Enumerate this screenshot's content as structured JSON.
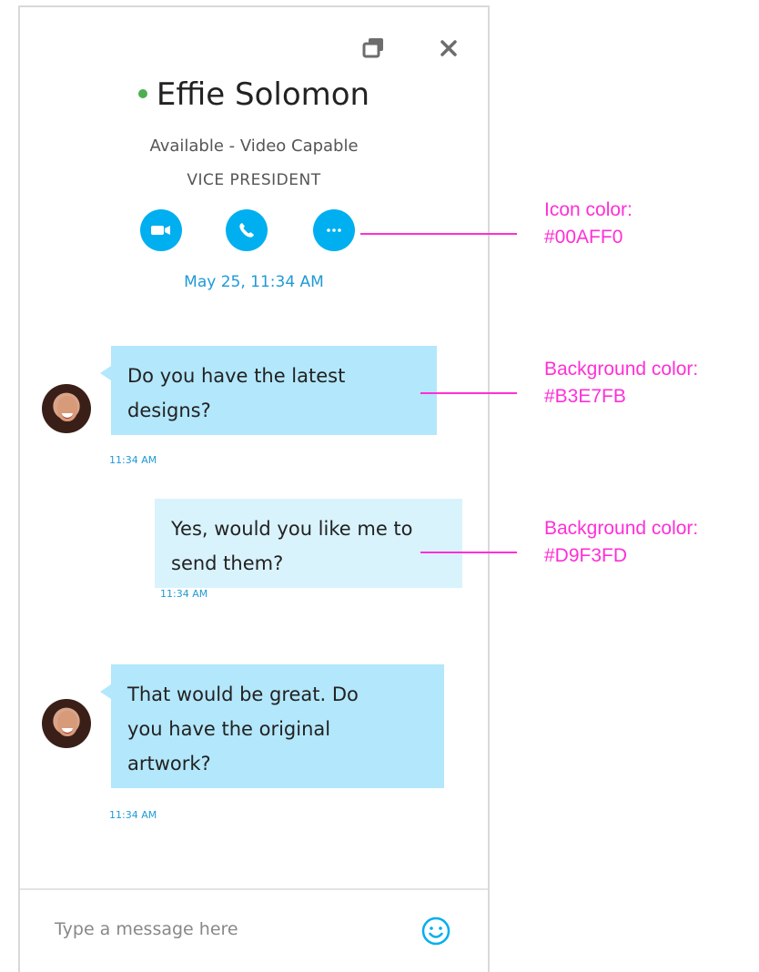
{
  "contact": {
    "name": "Effie Solomon",
    "status": "Available - Video Capable",
    "title": "VICE PRESIDENT",
    "presence_color": "#4caf50"
  },
  "icons": {
    "window": [
      "popout-icon",
      "close-icon"
    ],
    "calls": [
      "video-call-icon",
      "phone-call-icon",
      "more-options-icon"
    ],
    "composer": "emoji-icon"
  },
  "colors": {
    "icon": "#00AFF0",
    "incoming_bubble": "#B3E7FB",
    "outgoing_bubble": "#D9F3FD",
    "timestamp": "#1f9ad6"
  },
  "conversation": {
    "date": "May 25, 11:34 AM",
    "messages": [
      {
        "direction": "incoming",
        "lines": [
          "Do you have the latest",
          "designs?"
        ],
        "time": "11:34 AM"
      },
      {
        "direction": "outgoing",
        "lines": [
          "Yes, would you like me to",
          "send them?"
        ],
        "time": "11:34 AM"
      },
      {
        "direction": "incoming",
        "lines": [
          "That would be great. Do",
          "you have the original",
          "artwork?"
        ],
        "time": "11:34 AM"
      }
    ]
  },
  "composer": {
    "placeholder": "Type a message here"
  },
  "annotations": [
    {
      "label": "Icon color:",
      "value": "#00AFF0"
    },
    {
      "label": "Background color:",
      "value": "#B3E7FB"
    },
    {
      "label": "Background color:",
      "value": "#D9F3FD"
    }
  ]
}
